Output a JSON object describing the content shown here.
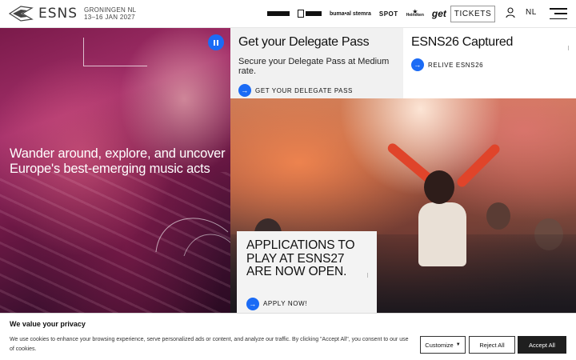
{
  "header": {
    "logo_text": "ESNS",
    "location": "GRONINGEN NL",
    "dates": "13–16 JAN 2027",
    "sponsors": [
      "",
      "",
      "buma•al stemra",
      "SPOT",
      "Heineken",
      "get"
    ],
    "tickets_label": "TICKETS",
    "language_label": "NL"
  },
  "hero": {
    "title": "Wander around, explore, and uncover Europe's best-emerging music acts"
  },
  "cards": {
    "delegate": {
      "title": "Get your Delegate Pass",
      "text": "Secure your Delegate Pass at Medium rate.",
      "cta": "GET YOUR DELEGATE PASS"
    },
    "captured": {
      "title": "ESNS26 Captured",
      "cta": "RELIVE ESNS26"
    },
    "applications": {
      "title": "APPLICATIONS TO PLAY AT ESNS27 ARE NOW OPEN.",
      "cta": "APPLY NOW!"
    }
  },
  "cookie": {
    "title": "We value your privacy",
    "text": "We use cookies to enhance your browsing experience, serve personalized ads or content, and analyze our traffic. By clicking \"Accept All\", you consent to our use of cookies.",
    "customize_label": "Customize",
    "reject_label": "Reject All",
    "accept_label": "Accept All"
  },
  "colors": {
    "accent": "#1b6bf5",
    "accept_button": "#1f1f1f"
  },
  "icons": [
    "esns-logo-icon",
    "user-icon",
    "menu-icon",
    "pause-icon",
    "arrow-right-icon",
    "chevron-down-icon"
  ]
}
